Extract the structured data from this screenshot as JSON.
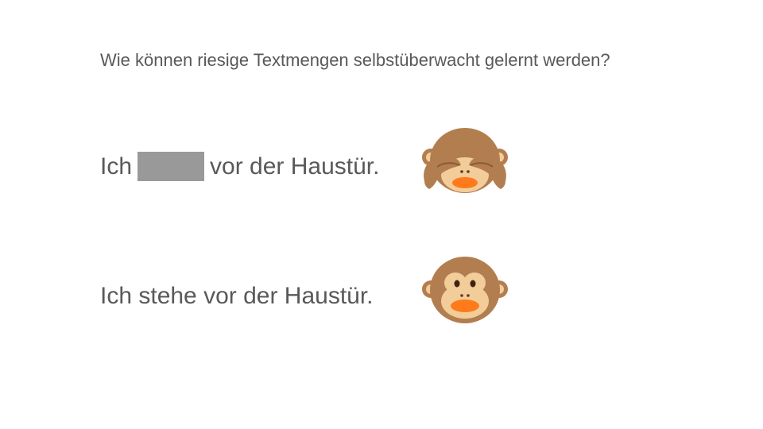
{
  "slide": {
    "question": "Wie können riesige Textmengen selbstüberwacht gelernt werden?",
    "masked_sentence": {
      "before": "Ich",
      "after": "vor der Haustür."
    },
    "full_sentence": "Ich stehe vor der Haustür.",
    "icons": {
      "top": "see-no-evil-monkey-icon",
      "bottom": "monkey-face-icon"
    },
    "colors": {
      "text": "#595959",
      "mask": "#999999",
      "monkey_fur": "#B37E4F",
      "monkey_face": "#F2CC99",
      "monkey_mouth": "#FF7A1A"
    }
  }
}
